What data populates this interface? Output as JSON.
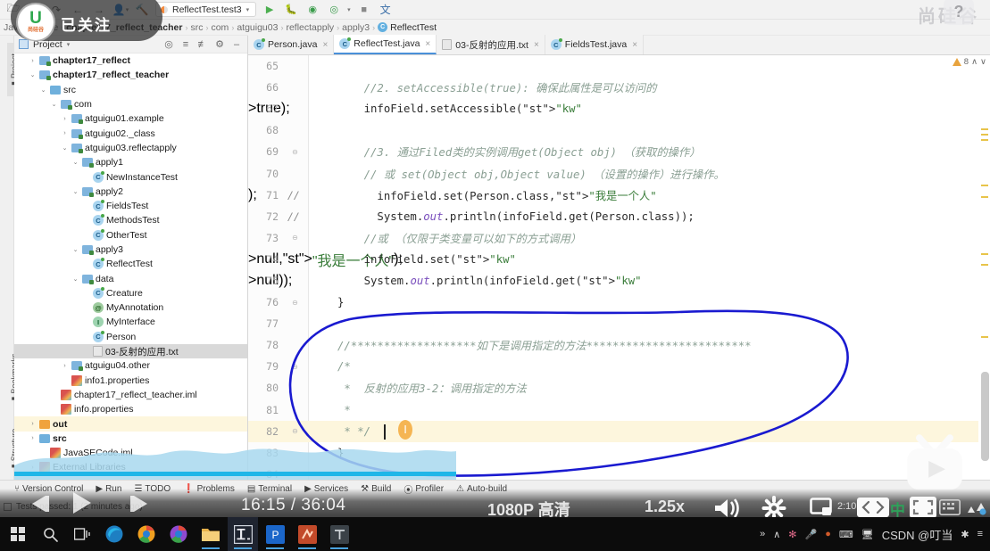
{
  "toolbar": {
    "back_icon": "back-arrow-icon",
    "forward_icon": "forward-arrow-icon",
    "run_config": "ReflectTest.test3",
    "icons": [
      "folder-icon",
      "undo-icon",
      "redo-icon",
      "back-arrow-icon",
      "forward-arrow-icon",
      "user-icon",
      "build-hammer-icon",
      "run-icon",
      "debug-icon",
      "run-coverage-icon",
      "profile-icon",
      "stop-icon",
      "translate-icon"
    ]
  },
  "breadcrumb": {
    "root": "JavaSECode",
    "items": [
      "chapter17_reflect_teacher",
      "src",
      "com",
      "atguigu03",
      "reflectapply",
      "apply3"
    ],
    "class": "ReflectTest",
    "separator": "›"
  },
  "left_rail": {
    "project_label": "Project",
    "bookmarks_label": "Bookmarks",
    "structure_label": "Structure"
  },
  "project_panel": {
    "title": "Project",
    "caret": "▾",
    "header_icons": [
      "locate-icon",
      "expand-all-icon",
      "collapse-all-icon",
      "settings-gear-icon",
      "minimize-icon"
    ],
    "tree": [
      {
        "label": "chapter17_reflect",
        "indent": 1,
        "arrow": "›",
        "icon": "module-folder-icon",
        "bold": true,
        "sel": ""
      },
      {
        "label": "chapter17_reflect_teacher",
        "indent": 1,
        "arrow": "⌄",
        "icon": "module-folder-icon",
        "bold": true,
        "sel": ""
      },
      {
        "label": "src",
        "indent": 2,
        "arrow": "⌄",
        "icon": "source-folder-icon",
        "bold": false,
        "sel": ""
      },
      {
        "label": "com",
        "indent": 3,
        "arrow": "⌄",
        "icon": "package-folder-icon",
        "bold": false,
        "sel": ""
      },
      {
        "label": "atguigu01.example",
        "indent": 4,
        "arrow": "›",
        "icon": "package-folder-icon",
        "bold": false,
        "sel": ""
      },
      {
        "label": "atguigu02._class",
        "indent": 4,
        "arrow": "›",
        "icon": "package-folder-icon",
        "bold": false,
        "sel": ""
      },
      {
        "label": "atguigu03.reflectapply",
        "indent": 4,
        "arrow": "⌄",
        "icon": "package-folder-icon",
        "bold": false,
        "sel": ""
      },
      {
        "label": "apply1",
        "indent": 5,
        "arrow": "⌄",
        "icon": "package-folder-icon",
        "bold": false,
        "sel": ""
      },
      {
        "label": "NewInstanceTest",
        "indent": 6,
        "arrow": "",
        "icon": "java-class-icon",
        "bold": false,
        "sel": ""
      },
      {
        "label": "apply2",
        "indent": 5,
        "arrow": "⌄",
        "icon": "package-folder-icon",
        "bold": false,
        "sel": ""
      },
      {
        "label": "FieldsTest",
        "indent": 6,
        "arrow": "",
        "icon": "java-class-icon",
        "bold": false,
        "sel": ""
      },
      {
        "label": "MethodsTest",
        "indent": 6,
        "arrow": "",
        "icon": "java-class-icon",
        "bold": false,
        "sel": ""
      },
      {
        "label": "OtherTest",
        "indent": 6,
        "arrow": "",
        "icon": "java-class-icon",
        "bold": false,
        "sel": ""
      },
      {
        "label": "apply3",
        "indent": 5,
        "arrow": "⌄",
        "icon": "package-folder-icon",
        "bold": false,
        "sel": ""
      },
      {
        "label": "ReflectTest",
        "indent": 6,
        "arrow": "",
        "icon": "java-class-icon",
        "bold": false,
        "sel": ""
      },
      {
        "label": "data",
        "indent": 5,
        "arrow": "⌄",
        "icon": "package-folder-icon",
        "bold": false,
        "sel": ""
      },
      {
        "label": "Creature",
        "indent": 6,
        "arrow": "",
        "icon": "java-class-icon",
        "bold": false,
        "sel": ""
      },
      {
        "label": "MyAnnotation",
        "indent": 6,
        "arrow": "",
        "icon": "annotation-icon",
        "bold": false,
        "sel": ""
      },
      {
        "label": "MyInterface",
        "indent": 6,
        "arrow": "",
        "icon": "interface-icon",
        "bold": false,
        "sel": ""
      },
      {
        "label": "Person",
        "indent": 6,
        "arrow": "",
        "icon": "java-class-icon",
        "bold": false,
        "sel": ""
      },
      {
        "label": "03-反射的应用.txt",
        "indent": 6,
        "arrow": "",
        "icon": "text-file-icon",
        "bold": false,
        "sel": "gray"
      },
      {
        "label": "atguigu04.other",
        "indent": 4,
        "arrow": "›",
        "icon": "package-folder-icon",
        "bold": false,
        "sel": ""
      },
      {
        "label": "info1.properties",
        "indent": 4,
        "arrow": "",
        "icon": "properties-file-icon",
        "bold": false,
        "sel": ""
      },
      {
        "label": "chapter17_reflect_teacher.iml",
        "indent": 3,
        "arrow": "",
        "icon": "iml-file-icon",
        "bold": false,
        "sel": ""
      },
      {
        "label": "info.properties",
        "indent": 3,
        "arrow": "",
        "icon": "properties-file-icon",
        "bold": false,
        "sel": ""
      },
      {
        "label": "out",
        "indent": 1,
        "arrow": "›",
        "icon": "out-folder-icon",
        "bold": true,
        "sel": "yellow"
      },
      {
        "label": "src",
        "indent": 1,
        "arrow": "›",
        "icon": "source-folder-icon",
        "bold": true,
        "sel": ""
      },
      {
        "label": "JavaSECode.iml",
        "indent": 2,
        "arrow": "",
        "icon": "iml-file-icon",
        "bold": false,
        "sel": ""
      },
      {
        "label": "External Libraries",
        "indent": 1,
        "arrow": "›",
        "icon": "library-icon",
        "bold": false,
        "sel": ""
      }
    ]
  },
  "editor": {
    "tabs": [
      {
        "label": "Person.java",
        "icon": "java-class-icon",
        "active": false
      },
      {
        "label": "ReflectTest.java",
        "icon": "java-class-icon",
        "active": true
      },
      {
        "label": "03-反射的应用.txt",
        "icon": "text-file-icon",
        "active": false
      },
      {
        "label": "FieldsTest.java",
        "icon": "java-class-icon",
        "active": false
      }
    ],
    "close_glyph": "×",
    "warning_count": "8",
    "warning_up": "∧",
    "warning_down": "∨",
    "lines": [
      {
        "n": "65",
        "comment": "",
        "code": "",
        "hl": false,
        "fold": ""
      },
      {
        "n": "66",
        "comment": "",
        "code": "    //2. setAccessible(true): 确保此属性是可以访问的",
        "hl": false,
        "fold": ""
      },
      {
        "n": "67",
        "comment": "",
        "code": "    infoField.setAccessible(true);",
        "hl": false,
        "fold": ""
      },
      {
        "n": "68",
        "comment": "",
        "code": "",
        "hl": false,
        "fold": ""
      },
      {
        "n": "69",
        "comment": "",
        "code": "    //3. 通过Filed类的实例调用get(Object obj) （获取的操作）",
        "hl": false,
        "fold": "⊖"
      },
      {
        "n": "70",
        "comment": "",
        "code": "    // 或 set(Object obj,Object value) （设置的操作）进行操作。",
        "hl": false,
        "fold": ""
      },
      {
        "n": "71",
        "comment": "//",
        "code": "      infoField.set(Person.class,\"我是一个人\");",
        "hl": false,
        "fold": ""
      },
      {
        "n": "72",
        "comment": "//",
        "code": "      System.out.println(infoField.get(Person.class));",
        "hl": false,
        "fold": ""
      },
      {
        "n": "73",
        "comment": "",
        "code": "    //或 （仅限于类变量可以如下的方式调用）",
        "hl": false,
        "fold": "⊖"
      },
      {
        "n": "74",
        "comment": "",
        "code": "    infoField.set(null,\"我是一个人\");",
        "hl": false,
        "fold": ""
      },
      {
        "n": "75",
        "comment": "",
        "code": "    System.out.println(infoField.get(null));",
        "hl": false,
        "fold": ""
      },
      {
        "n": "76",
        "comment": "",
        "code": "}",
        "hl": false,
        "fold": "⊖"
      },
      {
        "n": "77",
        "comment": "",
        "code": "",
        "hl": false,
        "fold": ""
      },
      {
        "n": "78",
        "comment": "",
        "code": "//*******************如下是调用指定的方法*************************",
        "hl": false,
        "fold": ""
      },
      {
        "n": "79",
        "comment": "",
        "code": "/*",
        "hl": false,
        "fold": "⊖"
      },
      {
        "n": "80",
        "comment": "",
        "code": " *  反射的应用3-2：调用指定的方法",
        "hl": false,
        "fold": ""
      },
      {
        "n": "81",
        "comment": "",
        "code": " *",
        "hl": false,
        "fold": ""
      },
      {
        "n": "82",
        "comment": "",
        "code": " * */",
        "hl": true,
        "fold": "⊖"
      },
      {
        "n": "83",
        "comment": "",
        "code": "}",
        "hl": false,
        "fold": ""
      },
      {
        "n": "84",
        "comment": "",
        "code": "",
        "hl": false,
        "fold": ""
      }
    ]
  },
  "tool_window_bar": {
    "items": [
      {
        "label": "Version Control",
        "icon": "branch-icon"
      },
      {
        "label": "Run",
        "icon": "run-triangle-icon"
      },
      {
        "label": "TODO",
        "icon": "todo-list-icon"
      },
      {
        "label": "Problems",
        "icon": "problems-icon"
      },
      {
        "label": "Terminal",
        "icon": "terminal-icon"
      },
      {
        "label": "Services",
        "icon": "services-icon"
      },
      {
        "label": "Build",
        "icon": "hammer-icon"
      },
      {
        "label": "Profiler",
        "icon": "profiler-icon"
      },
      {
        "label": "Auto-build",
        "icon": "warning-triangle-icon"
      }
    ]
  },
  "status_bar": {
    "text": "Tests passed: 1 (2 minutes ago)"
  },
  "video_overlay": {
    "prev_icon": "previous-episode-icon",
    "play_icon": "play-icon",
    "next_icon": "next-episode-icon",
    "time": "16:15 / 36:04",
    "quality": "1080P 高清",
    "speed": "1.25x",
    "volume_icon": "volume-icon",
    "settings_icon": "gear-icon",
    "pip_icon": "picture-in-picture-icon",
    "widescreen_icon": "widescreen-icon",
    "fullscreen_icon": "fullscreen-icon",
    "follow_label": "已关注",
    "avatar_letter": "U",
    "avatar_sub": "尚硅谷",
    "watermark_brand": "尚硅谷",
    "watermark_help": "?",
    "watermark_tv": "bilibili-tv-icon"
  },
  "taskbar": {
    "items": [
      {
        "icon": "windows-start-icon",
        "name": "start-button",
        "active": false
      },
      {
        "icon": "search-icon",
        "name": "search-button",
        "active": false
      },
      {
        "icon": "task-view-icon",
        "name": "task-view-button",
        "active": false
      },
      {
        "icon": "edge-icon",
        "name": "edge-app",
        "active": false
      },
      {
        "icon": "chrome-icon",
        "name": "chrome-app",
        "active": false
      },
      {
        "icon": "chrome-canary-icon",
        "name": "chrome-canary-app",
        "active": false
      },
      {
        "icon": "file-explorer-icon",
        "name": "file-explorer-app",
        "active": false
      },
      {
        "icon": "intellij-idea-icon",
        "name": "intellij-app",
        "active": true
      },
      {
        "icon": "powerpoint-icon",
        "name": "powerpoint-app",
        "active": false
      },
      {
        "icon": "xmind-icon",
        "name": "xmind-app",
        "active": false
      },
      {
        "icon": "typora-icon",
        "name": "typora-app",
        "active": false
      }
    ],
    "tray": {
      "overflow": "»",
      "chevron": "∧",
      "clock": "2:10",
      "ime_label": "中",
      "csdn_text": "CSDN @叮当",
      "icons": [
        "overflow-icon",
        "chevron-up-icon",
        "flower-icon",
        "microphone-icon",
        "record-icon",
        "keyboard-icon",
        "monitor-icon",
        "notification-icon"
      ]
    }
  }
}
